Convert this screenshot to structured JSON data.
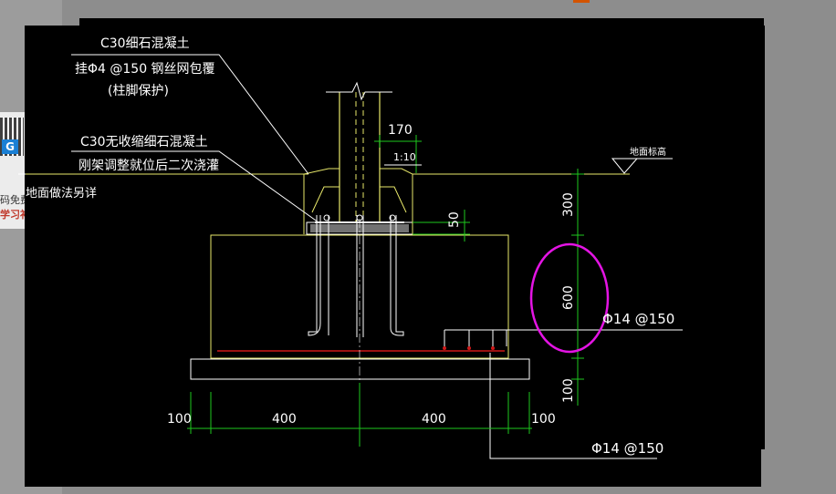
{
  "promo": {
    "line1": "码免费",
    "line2": "学习补",
    "logo_letter": "G"
  },
  "drawing": {
    "note_concrete_fine": "C30细石混凝土",
    "note_wire_mesh": "挂Φ4 @150 钢丝网包覆",
    "note_column_protect": "(柱脚保护)",
    "note_nonshrink": "C30无收缩细石混凝土",
    "note_grouting": "刚架调整就位后二次浇灌",
    "note_ground_finish": "地面做法另详",
    "dim_170": "170",
    "slope_label": "1:10",
    "ground_level_label": "地面标高",
    "dim_50": "50",
    "dim_300": "300",
    "dim_600": "600",
    "dim_100_vertical": "100",
    "rebar_label_right": "Φ14 @150",
    "rebar_label_bottom": "Φ14 @150",
    "dim_100_left": "100",
    "dim_400_left": "400",
    "dim_400_right": "400",
    "dim_100_right": "100"
  },
  "colors": {
    "cad_background": "#000000",
    "line_white": "#ffffff",
    "line_yellow": "#e8e86a",
    "dimension_green": "#1ec81e",
    "rebar_red": "#d01818",
    "highlight_magenta": "#e414e4"
  }
}
